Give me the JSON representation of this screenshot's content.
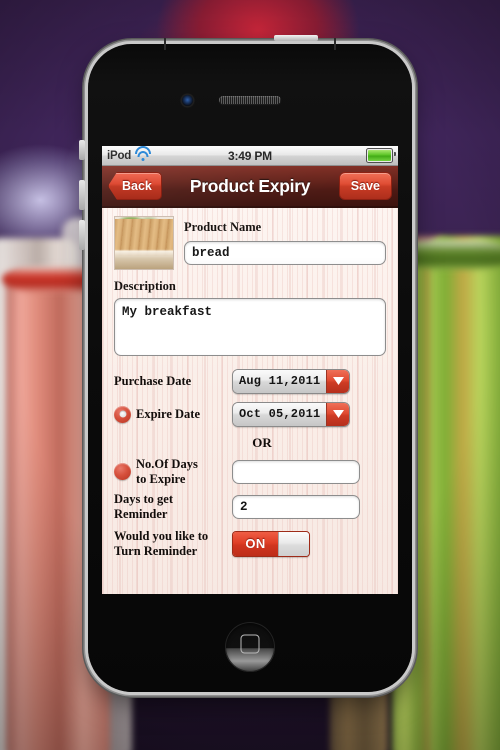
{
  "status_bar": {
    "carrier": "iPod",
    "wifi_icon": "wifi-icon",
    "time": "3:49 PM",
    "battery_icon": "battery-full-icon"
  },
  "nav_bar": {
    "back_label": "Back",
    "title": "Product Expiry",
    "save_label": "Save"
  },
  "form": {
    "thumbnail_name": "product-photo-bread",
    "product_name_label": "Product Name",
    "product_name_value": "bread",
    "product_name_placeholder": "",
    "description_label": "Description",
    "description_value": "My breakfast",
    "description_placeholder": "",
    "purchase_date_label": "Purchase Date",
    "purchase_date_value": "Aug 11,2011",
    "expire_date_label": "Expire Date",
    "expire_date_value": "Oct 05,2011",
    "expire_date_selected": true,
    "or_label": "OR",
    "days_to_expire_label_line1": "No.Of Days",
    "days_to_expire_label_line2": "to Expire",
    "days_to_expire_value": "",
    "days_to_expire_placeholder": "",
    "days_to_expire_selected": false,
    "reminder_days_label_line1": "Days to get",
    "reminder_days_label_line2": "Reminder",
    "reminder_days_value": "2",
    "reminder_days_placeholder": "",
    "turn_reminder_label_line1": "Would you like to",
    "turn_reminder_label_line2": "Turn Reminder",
    "turn_reminder_state": "ON",
    "dropdown_icon": "chevron-down-icon"
  },
  "device": {
    "home_button": "home-button",
    "earpiece": "earpiece-speaker",
    "front_camera": "front-camera"
  },
  "colors": {
    "accent_red": "#e04a31",
    "navbar_dark_red": "#5e1d15",
    "form_bg": "#fbf1ec",
    "wifi_blue": "#1b7fd4",
    "battery_green": "#58c421"
  }
}
